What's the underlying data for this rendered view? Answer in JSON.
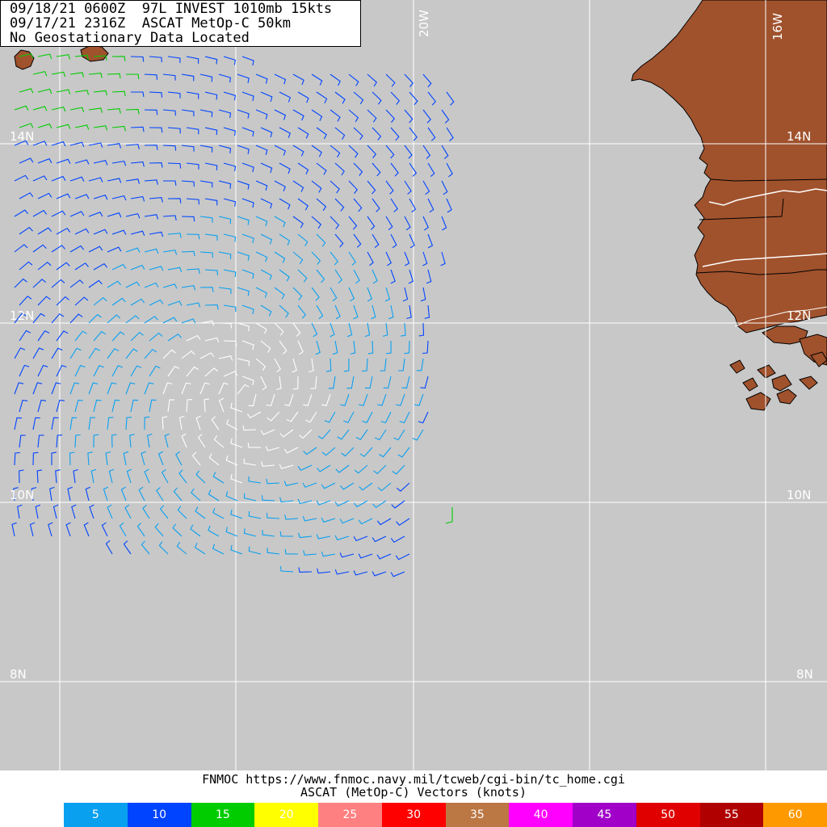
{
  "title": {
    "line1": "09/18/21 0600Z  97L INVEST 1010mb 15kts",
    "line2": "09/17/21 2316Z  ASCAT MetOp-C 50km",
    "line3": "No Geostationary Data Located"
  },
  "map": {
    "ocean_color": "#c8c8c8",
    "land_color": "#a0522d",
    "grid_color": "#ffffff",
    "lat_labels": [
      "14N",
      "12N",
      "10N",
      "8N"
    ],
    "lon_labels": [
      "20W",
      "16W"
    ]
  },
  "footer": {
    "source": "FNMOC https://www.fnmoc.navy.mil/tcweb/cgi-bin/tc_home.cgi",
    "legend_title": "ASCAT (MetOp-C) Vectors (knots)"
  },
  "legend": [
    {
      "label": "5",
      "color": "#0aa0f0"
    },
    {
      "label": "10",
      "color": "#0044ff"
    },
    {
      "label": "15",
      "color": "#00cc00"
    },
    {
      "label": "20",
      "color": "#ffff00"
    },
    {
      "label": "25",
      "color": "#ff8080"
    },
    {
      "label": "30",
      "color": "#ff0000"
    },
    {
      "label": "35",
      "color": "#bb7744"
    },
    {
      "label": "40",
      "color": "#ff00ff"
    },
    {
      "label": "45",
      "color": "#a000c8"
    },
    {
      "label": "50",
      "color": "#e00000"
    },
    {
      "label": "55",
      "color": "#b00000"
    },
    {
      "label": "60",
      "color": "#ff9900"
    }
  ]
}
